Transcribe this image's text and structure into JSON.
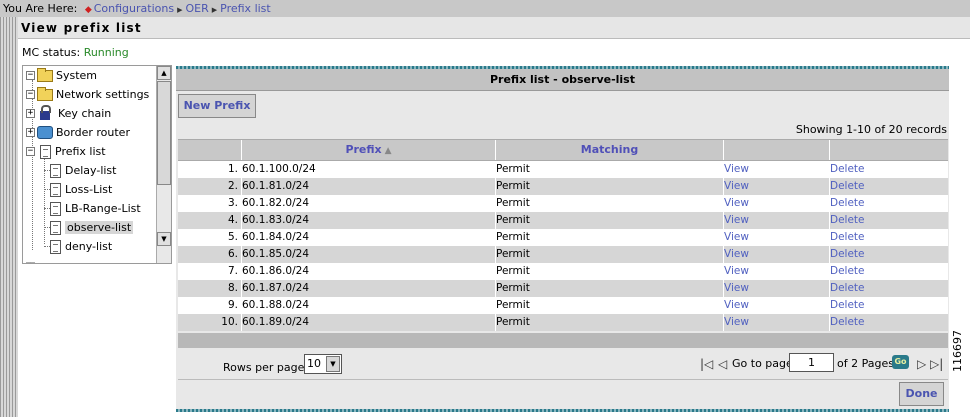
{
  "breadcrumb": {
    "prefix": "You Are Here:",
    "items": [
      "Configurations",
      "OER",
      "Prefix list"
    ]
  },
  "page_title": "View prefix list",
  "mc_status": {
    "label": "MC status:",
    "value": "Running",
    "value_color": "#2a8a2a"
  },
  "tree": {
    "items": [
      {
        "label": "System",
        "icon": "folder-icon",
        "expander": "minus"
      },
      {
        "label": "Network settings",
        "icon": "folder-icon",
        "expander": "minus"
      },
      {
        "label": "Key chain",
        "icon": "lock-icon",
        "expander": "plus"
      },
      {
        "label": "Border router",
        "icon": "router-icon",
        "expander": "plus"
      },
      {
        "label": "Prefix list",
        "icon": "document-icon",
        "expander": "minus"
      },
      {
        "label": "Delay-list",
        "icon": "document-icon"
      },
      {
        "label": "Loss-List",
        "icon": "document-icon"
      },
      {
        "label": "LB-Range-List",
        "icon": "document-icon"
      },
      {
        "label": "observe-list",
        "icon": "document-icon",
        "selected": true
      },
      {
        "label": "deny-list",
        "icon": "document-icon"
      }
    ]
  },
  "panel": {
    "title": "Prefix list - observe-list",
    "new_prefix_label": "New Prefix",
    "showing_text": "Showing 1-10 of 20 records",
    "columns": {
      "prefix": "Prefix",
      "matching": "Matching"
    },
    "rows": [
      {
        "num": "1.",
        "prefix": "60.1.100.0/24",
        "matching": "Permit",
        "view": "View",
        "delete": "Delete"
      },
      {
        "num": "2.",
        "prefix": "60.1.81.0/24",
        "matching": "Permit",
        "view": "View",
        "delete": "Delete"
      },
      {
        "num": "3.",
        "prefix": "60.1.82.0/24",
        "matching": "Permit",
        "view": "View",
        "delete": "Delete"
      },
      {
        "num": "4.",
        "prefix": "60.1.83.0/24",
        "matching": "Permit",
        "view": "View",
        "delete": "Delete"
      },
      {
        "num": "5.",
        "prefix": "60.1.84.0/24",
        "matching": "Permit",
        "view": "View",
        "delete": "Delete"
      },
      {
        "num": "6.",
        "prefix": "60.1.85.0/24",
        "matching": "Permit",
        "view": "View",
        "delete": "Delete"
      },
      {
        "num": "7.",
        "prefix": "60.1.86.0/24",
        "matching": "Permit",
        "view": "View",
        "delete": "Delete"
      },
      {
        "num": "8.",
        "prefix": "60.1.87.0/24",
        "matching": "Permit",
        "view": "View",
        "delete": "Delete"
      },
      {
        "num": "9.",
        "prefix": "60.1.88.0/24",
        "matching": "Permit",
        "view": "View",
        "delete": "Delete"
      },
      {
        "num": "10.",
        "prefix": "60.1.89.0/24",
        "matching": "Permit",
        "view": "View",
        "delete": "Delete"
      }
    ],
    "pager": {
      "rows_per_page_label": "Rows per page:",
      "rows_per_page_value": "10",
      "goto_label": "Go to page:",
      "page_value": "1",
      "pages_label": "of 2 Pages",
      "go_label": "Go"
    },
    "done_label": "Done"
  },
  "figure_id": "116697",
  "colors": {
    "link": "#5060c0",
    "status_running": "#2a8a2a",
    "accent_stripe": "#2a7a8a"
  }
}
